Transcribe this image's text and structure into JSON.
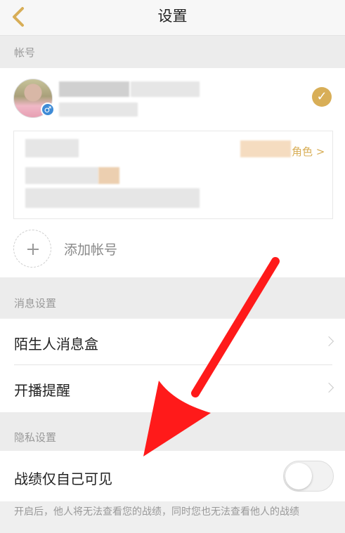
{
  "header": {
    "title": "设置",
    "back_icon": "chevron-left-icon",
    "accent": "#d8ae57"
  },
  "account": {
    "section_title": "帐号",
    "role_link": "角色 >",
    "add_account_label": "添加帐号"
  },
  "messages": {
    "section_title": "消息设置",
    "items": [
      {
        "label": "陌生人消息盒"
      },
      {
        "label": "开播提醒"
      }
    ]
  },
  "privacy": {
    "section_title": "隐私设置",
    "toggle_label": "战绩仅自己可见",
    "toggle_on": false,
    "note": "开启后，他人将无法查看您的战绩，同时您也无法查看他人的战绩"
  },
  "annotation": {
    "arrow_color": "#ff1a1a"
  }
}
